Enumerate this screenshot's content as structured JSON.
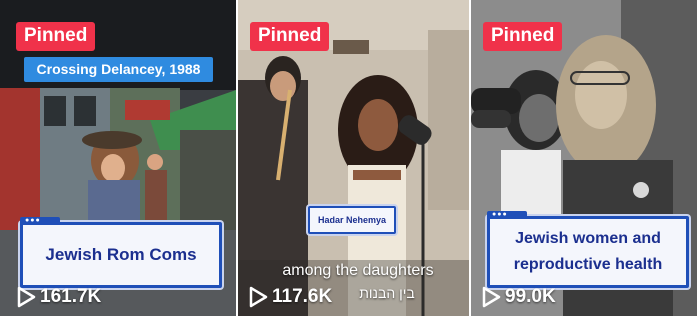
{
  "tiles": [
    {
      "pinned_label": "Pinned",
      "caption": "Crossing Delancey, 1988",
      "card_title": "Jewish Rom Coms",
      "views": "161.7K",
      "icon": "play-icon"
    },
    {
      "pinned_label": "Pinned",
      "name_tag": "Hadar Nehemya",
      "subtitle_line1": "among the daughters",
      "subtitle_line2": "בין הבנות",
      "views": "117.6K",
      "icon": "play-icon"
    },
    {
      "pinned_label": "Pinned",
      "card_title_line1": "Jewish women and",
      "card_title_line2": "reproductive health",
      "views": "99.0K",
      "icon": "play-icon"
    }
  ],
  "colors": {
    "pinned_bg": "#f0324a",
    "caption_bg": "#2f8be0",
    "card_border": "#1f4fb8",
    "card_text": "#1b2f8f"
  }
}
